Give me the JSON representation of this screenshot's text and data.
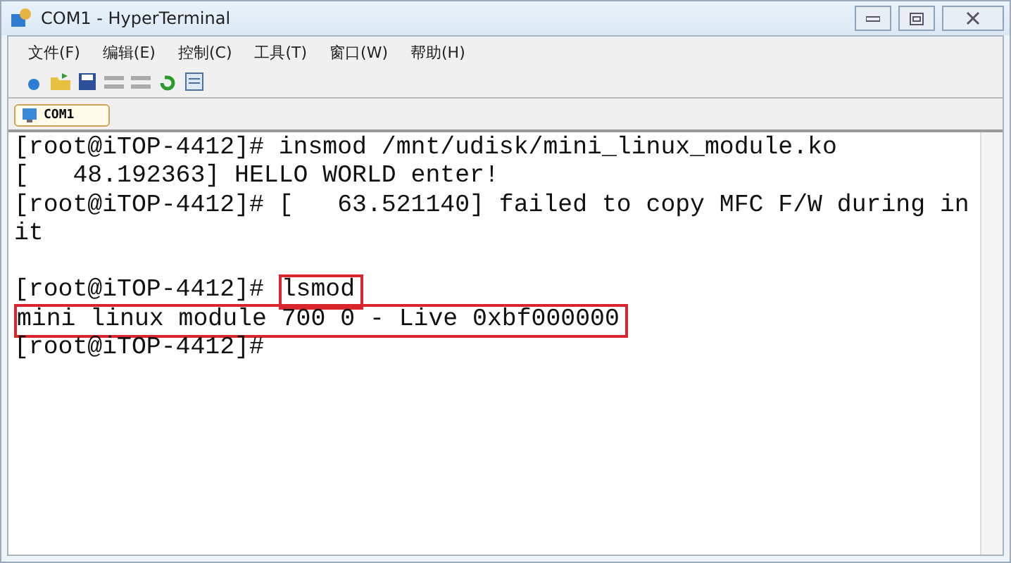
{
  "window": {
    "title": "COM1 - HyperTerminal"
  },
  "menu": [
    "文件(F)",
    "编辑(E)",
    "控制(C)",
    "工具(T)",
    "窗口(W)",
    "帮助(H)"
  ],
  "toolbar": [
    {
      "kind": "new",
      "disabled": false
    },
    {
      "kind": "open",
      "disabled": false
    },
    {
      "kind": "save",
      "disabled": false
    },
    {
      "kind": "stp",
      "disabled": true
    },
    {
      "kind": "scp",
      "disabled": true
    },
    {
      "kind": "reconnect",
      "disabled": false
    },
    {
      "kind": "properties",
      "disabled": false
    }
  ],
  "tabs": [
    {
      "label": "COM1",
      "selected": true
    }
  ],
  "terminal": {
    "lines": [
      {
        "kind": "text",
        "segments": [
          {
            "text": "[root@iTOP-4412]# insmod /mnt/udisk/mini_linux_module.ko",
            "highlighted": false
          }
        ]
      },
      {
        "kind": "text",
        "segments": [
          {
            "text": "[   48.192363] HELLO WORLD enter!",
            "highlighted": false
          }
        ]
      },
      {
        "kind": "text",
        "segments": [
          {
            "text": "[root@iTOP-4412]# [   63.521140] failed to copy MFC F/W during in",
            "highlighted": false
          }
        ]
      },
      {
        "kind": "text",
        "segments": [
          {
            "text": "it",
            "highlighted": false
          }
        ]
      },
      {
        "kind": "blank"
      },
      {
        "kind": "text",
        "segments": [
          {
            "text": "[root@iTOP-4412]# ",
            "highlighted": false
          },
          {
            "text": "lsmod",
            "highlighted": true
          }
        ]
      },
      {
        "kind": "text",
        "segments": [
          {
            "text": "mini linux module 700 0 - Live 0xbf000000",
            "highlighted": true
          }
        ]
      },
      {
        "kind": "text",
        "segments": [
          {
            "text": "[root@iTOP-4412]#",
            "highlighted": false
          }
        ]
      }
    ]
  }
}
